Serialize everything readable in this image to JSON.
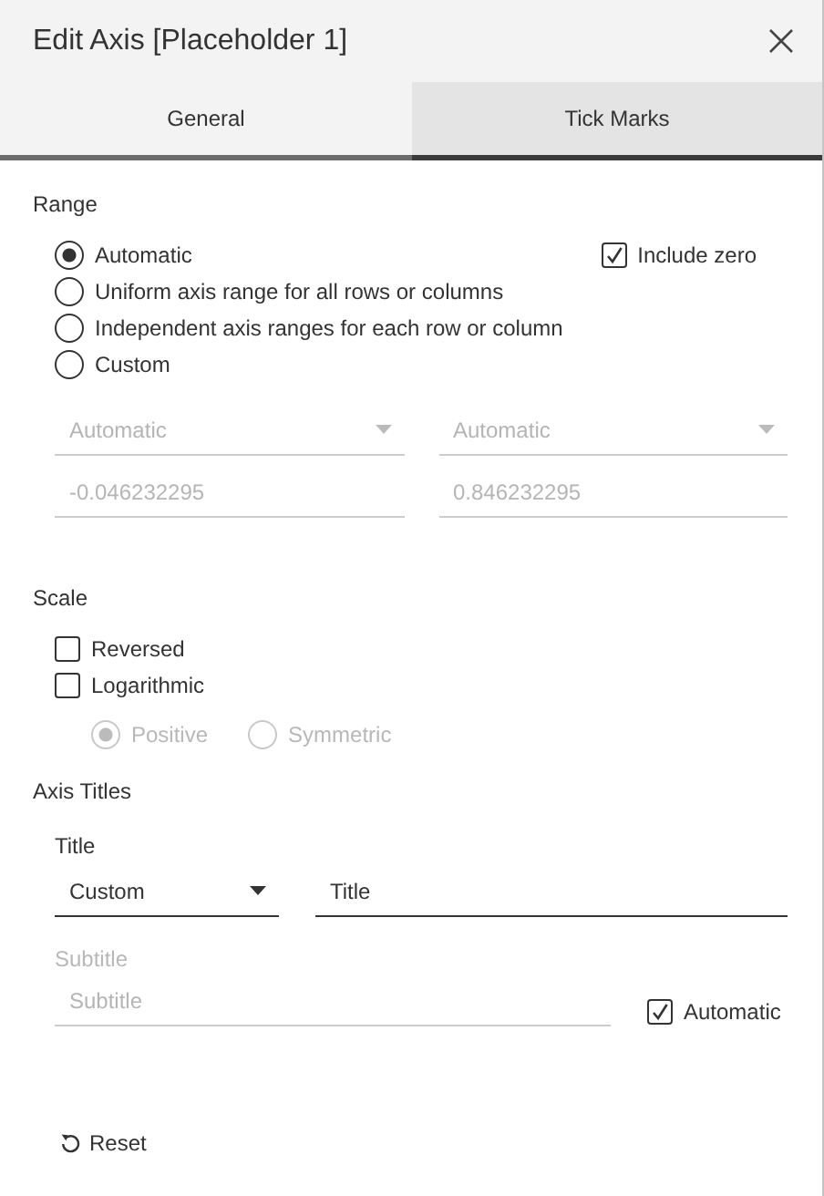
{
  "window": {
    "title": "Edit Axis [Placeholder 1]"
  },
  "tabs": [
    {
      "label": "General",
      "selected": true
    },
    {
      "label": "Tick Marks",
      "selected": false
    }
  ],
  "range": {
    "heading": "Range",
    "options": [
      {
        "label": "Automatic",
        "selected": true
      },
      {
        "label": "Uniform axis range for all rows or columns",
        "selected": false
      },
      {
        "label": "Independent axis ranges for each row or column",
        "selected": false
      },
      {
        "label": "Custom",
        "selected": false
      }
    ],
    "include_zero": {
      "label": "Include zero",
      "checked": true
    },
    "dropdowns": [
      {
        "value": "Automatic",
        "disabled": true
      },
      {
        "value": "Automatic",
        "disabled": true
      }
    ],
    "fields": [
      {
        "value": "-0.046232295",
        "disabled": true
      },
      {
        "value": "0.846232295",
        "disabled": true
      }
    ]
  },
  "scale": {
    "heading": "Scale",
    "checkboxes": [
      {
        "label": "Reversed",
        "checked": false
      },
      {
        "label": "Logarithmic",
        "checked": false
      }
    ],
    "log_options": [
      {
        "label": "Positive",
        "selected": true,
        "disabled": true
      },
      {
        "label": "Symmetric",
        "selected": false,
        "disabled": true
      }
    ]
  },
  "axis_titles": {
    "heading": "Axis Titles",
    "title": {
      "label": "Title",
      "dropdown": {
        "value": "Custom",
        "disabled": false
      },
      "field": {
        "value": "Title",
        "disabled": false
      }
    },
    "subtitle": {
      "label": "Subtitle",
      "disabled": true,
      "field": {
        "placeholder": "Subtitle",
        "disabled": true
      },
      "automatic": {
        "label": "Automatic",
        "checked": true
      }
    }
  },
  "reset": {
    "label": "Reset"
  }
}
